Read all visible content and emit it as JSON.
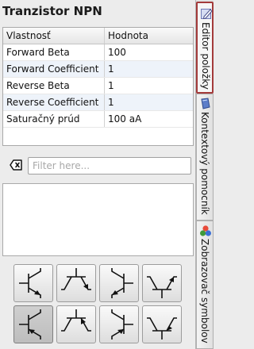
{
  "panel": {
    "title": "Tranzistor NPN",
    "table": {
      "headers": [
        "Vlastnosť",
        "Hodnota"
      ],
      "rows": [
        [
          "Forward Beta",
          "100"
        ],
        [
          "Forward Coefficient",
          "1"
        ],
        [
          "Reverse Beta",
          "1"
        ],
        [
          "Reverse Coefficient",
          "1"
        ],
        [
          "Saturačný prúd",
          "100 aA"
        ]
      ]
    },
    "filter": {
      "placeholder": "Filter here...",
      "value": "",
      "icon": "filter-clear-icon"
    },
    "symbol_buttons": [
      {
        "icon": "npn-transistor-symbol-icon"
      },
      {
        "icon": "npn-transistor-symbol-icon"
      },
      {
        "icon": "npn-transistor-symbol-icon"
      },
      {
        "icon": "npn-transistor-symbol-icon"
      },
      {
        "icon": "npn-transistor-symbol-icon",
        "selected": true
      },
      {
        "icon": "npn-transistor-symbol-icon"
      },
      {
        "icon": "npn-transistor-symbol-icon"
      },
      {
        "icon": "npn-transistor-symbol-icon"
      }
    ]
  },
  "dock_tabs": [
    {
      "label": "Editor položky",
      "icon": "edit-icon",
      "active": true
    },
    {
      "label": "Kontextový pomocník",
      "icon": "book-icon",
      "active": false
    },
    {
      "label": "Zobrazovač symbolov",
      "icon": "shapes-icon",
      "active": false
    }
  ],
  "colors": {
    "active_tab_border": "#a33a3a",
    "row_alt": "#eef3fa"
  }
}
